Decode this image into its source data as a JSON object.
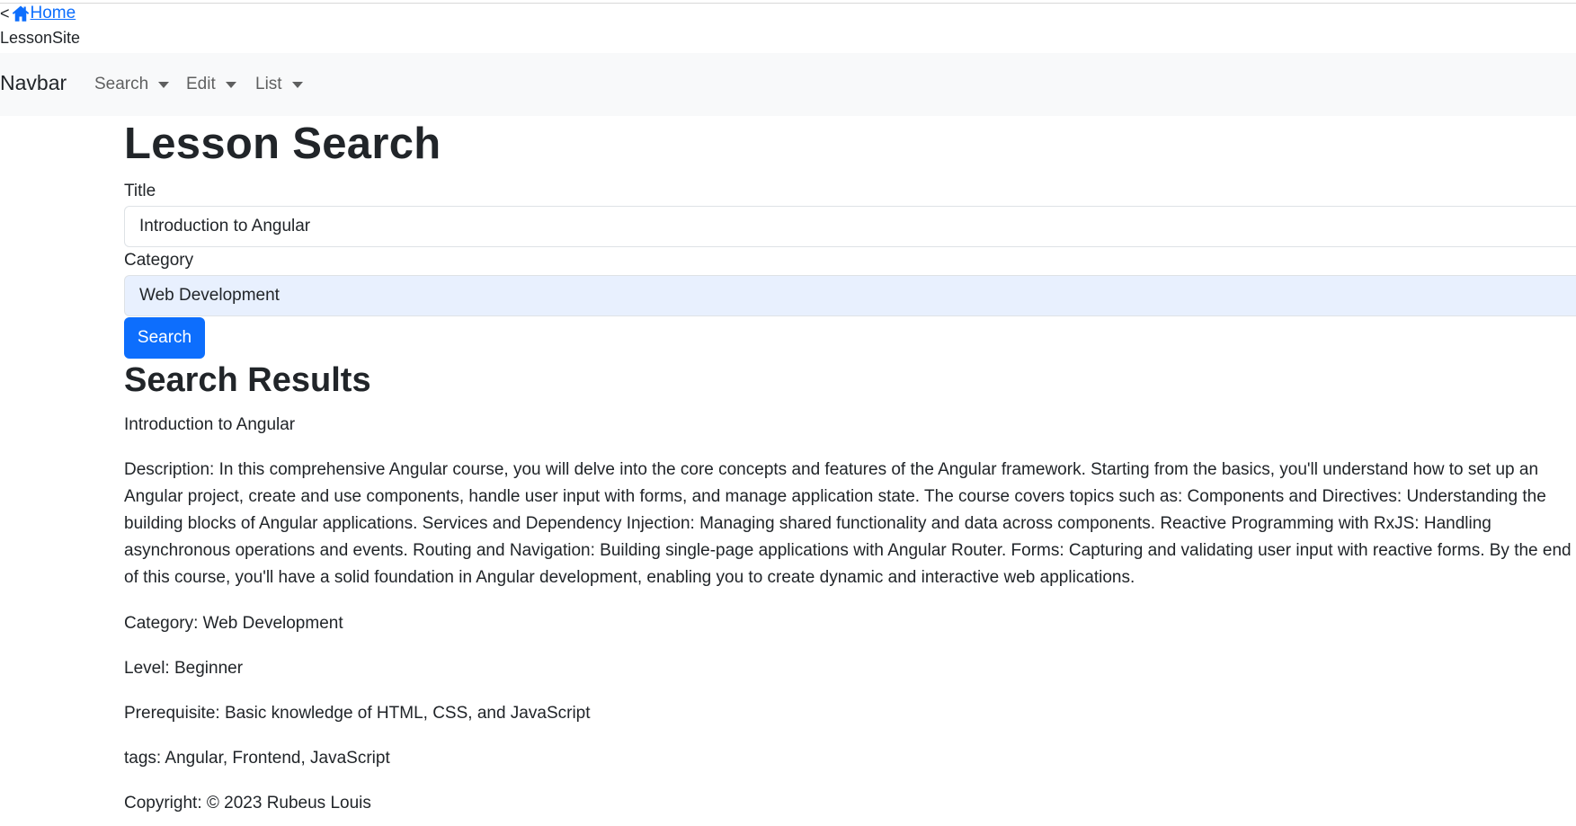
{
  "header": {
    "back_glyph": "<",
    "home_link": "Home",
    "site_name": "LessonSite"
  },
  "navbar": {
    "brand": "Navbar",
    "items": [
      {
        "label": "Search"
      },
      {
        "label": "Edit"
      },
      {
        "label": "List"
      }
    ]
  },
  "main": {
    "title": "Lesson Search",
    "form": {
      "title_label": "Title",
      "title_value": "Introduction to Angular",
      "category_label": "Category",
      "category_value": "Web Development",
      "search_button": "Search"
    },
    "results": {
      "heading": "Search Results",
      "lesson_title": "Introduction to Angular",
      "description": "Description: In this comprehensive Angular course, you will delve into the core concepts and features of the Angular framework. Starting from the basics, you'll understand how to set up an Angular project, create and use components, handle user input with forms, and manage application state. The course covers topics such as: Components and Directives: Understanding the building blocks of Angular applications. Services and Dependency Injection: Managing shared functionality and data across components. Reactive Programming with RxJS: Handling asynchronous operations and events. Routing and Navigation: Building single-page applications with Angular Router. Forms: Capturing and validating user input with reactive forms. By the end of this course, you'll have a solid foundation in Angular development, enabling you to create dynamic and interactive web applications.",
      "category": "Category: Web Development",
      "level": "Level: Beginner",
      "prerequisite": "Prerequisite: Basic knowledge of HTML, CSS, and JavaScript",
      "tags": "tags: Angular, Frontend, JavaScript",
      "copyright": "Copyright: © 2023 Rubeus Louis"
    }
  },
  "colors": {
    "link": "#0d6efd",
    "primary_button": "#0d6efd",
    "navbar_bg": "#f8f9fa",
    "autofill_bg": "#e8f0fe"
  },
  "icons": {
    "home": "home-icon",
    "dropdown": "caret-down-icon"
  }
}
